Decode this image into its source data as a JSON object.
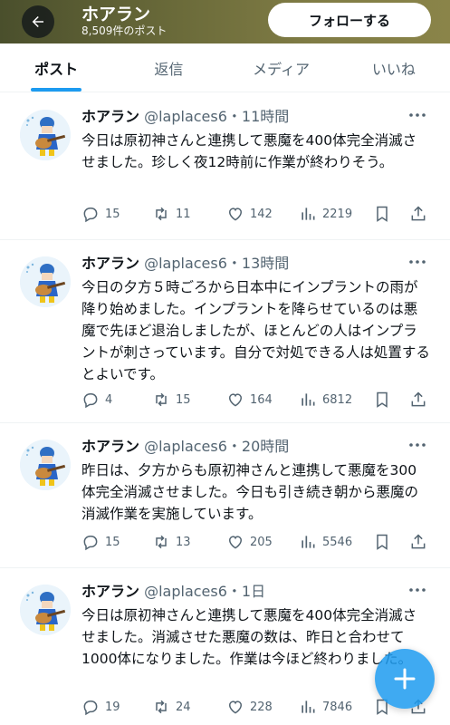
{
  "header": {
    "title": "ホアラン",
    "subtitle": "8,509件のポスト",
    "follow_label": "フォローする"
  },
  "tabs": [
    {
      "label": "ポスト",
      "active": true
    },
    {
      "label": "返信",
      "active": false
    },
    {
      "label": "メディア",
      "active": false
    },
    {
      "label": "いいね",
      "active": false
    }
  ],
  "posts": [
    {
      "name": "ホアラン",
      "meta": " @laplaces6・11時間",
      "text": "今日は原初神さんと連携して悪魔を400体完全消滅させました。珍しく夜12時前に作業が終わりそう。",
      "replies": "15",
      "reposts": "11",
      "likes": "142",
      "views": "2219"
    },
    {
      "name": "ホアラン",
      "meta": " @laplaces6・13時間",
      "text": "今日の夕方５時ごろから日本中にインプラントの雨が降り始めました。インプラントを降らせているのは悪魔で先ほど退治しましたが、ほとんどの人はインプラントが刺さっています。自分で対処できる人は処置するとよいです。",
      "replies": "4",
      "reposts": "15",
      "likes": "164",
      "views": "6812"
    },
    {
      "name": "ホアラン",
      "meta": " @laplaces6・20時間",
      "text": "昨日は、夕方からも原初神さんと連携して悪魔を300体完全消滅させました。今日も引き続き朝から悪魔の消滅作業を実施しています。",
      "replies": "15",
      "reposts": "13",
      "likes": "205",
      "views": "5546"
    },
    {
      "name": "ホアラン",
      "meta": " @laplaces6・1日",
      "text": "今日は原初神さんと連携して悪魔を400体完全消滅させました。消滅させた悪魔の数は、昨日と合わせて1000体になりました。作業は今ほど終わりました。",
      "replies": "19",
      "reposts": "24",
      "likes": "228",
      "views": "7846"
    }
  ],
  "colors": {
    "accent": "#1d9bf0",
    "text": "#0f1419",
    "secondary": "#536471"
  },
  "icons": [
    "back-arrow-icon",
    "more-icon",
    "reply-icon",
    "repost-icon",
    "like-icon",
    "views-icon",
    "bookmark-icon",
    "share-icon",
    "compose-plus-icon"
  ]
}
